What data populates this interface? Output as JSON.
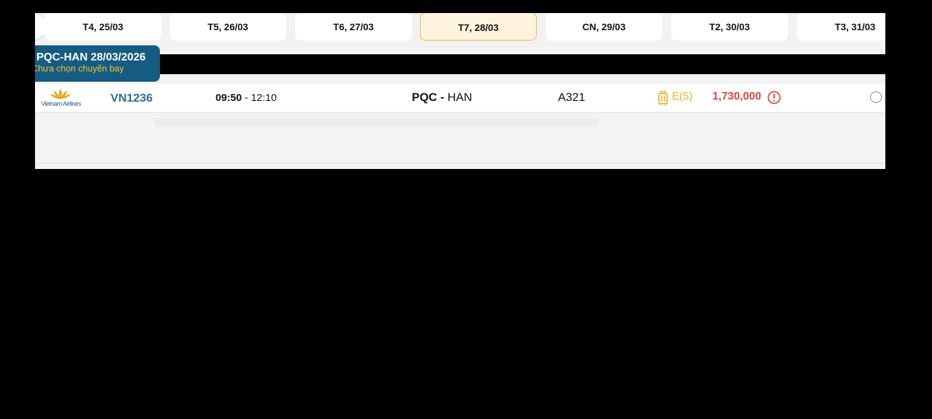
{
  "date_strip": {
    "tabs": [
      {
        "label": "T4, 25/03"
      },
      {
        "label": "T5, 26/03"
      },
      {
        "label": "T6, 27/03"
      },
      {
        "label": "T7, 28/03",
        "selected": true
      },
      {
        "label": "CN, 29/03"
      },
      {
        "label": "T2, 30/03"
      },
      {
        "label": "T3, 31/03"
      }
    ]
  },
  "route_badge": {
    "title": "PQC-HAN 28/03/2026",
    "subtitle": "Chưa chọn chuyến bay"
  },
  "flights": [
    {
      "airline": "Vietnam Airlines",
      "flight_no": "VN1236",
      "depart": "09:50",
      "separator": " - ",
      "arrive": "12:10",
      "origin": "PQC",
      "route_sep": " - ",
      "destination": "HAN",
      "aircraft": "A321",
      "fare_class": "E(5)",
      "price": "1,730,000",
      "icons": [
        "lotus-logo-icon",
        "luggage-icon",
        "alert-circle-icon",
        "radio-unchecked-icon"
      ]
    }
  ],
  "colors": {
    "accent_blue": "#165c82",
    "badge_subtitle": "#f3c430",
    "price_red": "#e0443f",
    "fare_yellow": "#e8b520",
    "selected_tab_bg": "#fff5de",
    "selected_tab_border": "#f0b43b"
  }
}
